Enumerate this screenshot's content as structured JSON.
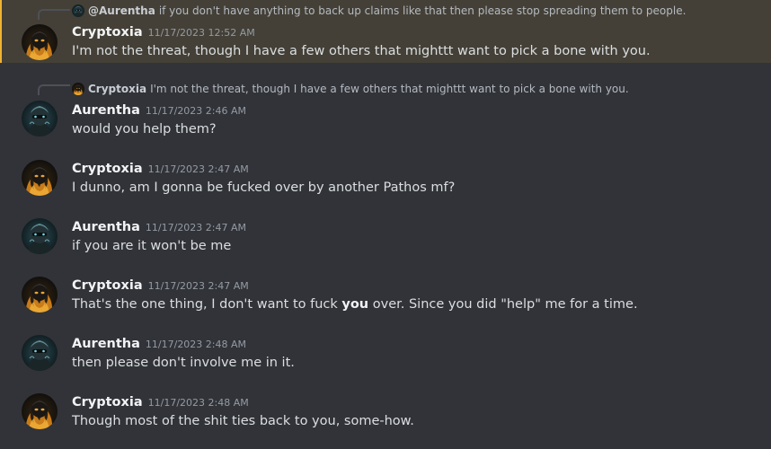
{
  "messages": [
    {
      "reply": {
        "mention_name": "@Aurentha",
        "text": "if you don't have anything to back up claims like that then please stop spreading them to people."
      },
      "username": "Cryptoxia",
      "timestamp": "11/17/2023 12:52 AM",
      "content": "I'm not the threat, though I have a few others that mighttt want to pick a bone with you."
    },
    {
      "reply": {
        "name": "Cryptoxia",
        "text": "I'm not the threat, though I have a few others that mighttt want to pick a bone with you."
      },
      "username": "Aurentha",
      "timestamp": "11/17/2023 2:46 AM",
      "content": "would you help them?"
    },
    {
      "username": "Cryptoxia",
      "timestamp": "11/17/2023 2:47 AM",
      "content": "I dunno, am I gonna be fucked over by another Pathos mf?"
    },
    {
      "username": "Aurentha",
      "timestamp": "11/17/2023 2:47 AM",
      "content": "if you are it won't be me"
    },
    {
      "username": "Cryptoxia",
      "timestamp": "11/17/2023 2:47 AM",
      "content_before": "That's the one thing, I don't want to fuck ",
      "content_bold": "you",
      "content_after": " over. Since you did \"help\" me for a time."
    },
    {
      "username": "Aurentha",
      "timestamp": "11/17/2023 2:48 AM",
      "content": "then please don't involve me in it."
    },
    {
      "username": "Cryptoxia",
      "timestamp": "11/17/2023 2:48 AM",
      "content": "Though most of the shit ties back to you, some-how."
    }
  ],
  "avatars": {
    "Cryptoxia": "cryptoxia-avatar-icon",
    "Aurentha": "aurentha-avatar-icon"
  },
  "colors": {
    "background": "#313338",
    "highlight": "#444037",
    "highlight_bar": "#f0b232",
    "username": "#f2f3f5",
    "text": "#dbdee1",
    "timestamp": "#949ba4"
  }
}
